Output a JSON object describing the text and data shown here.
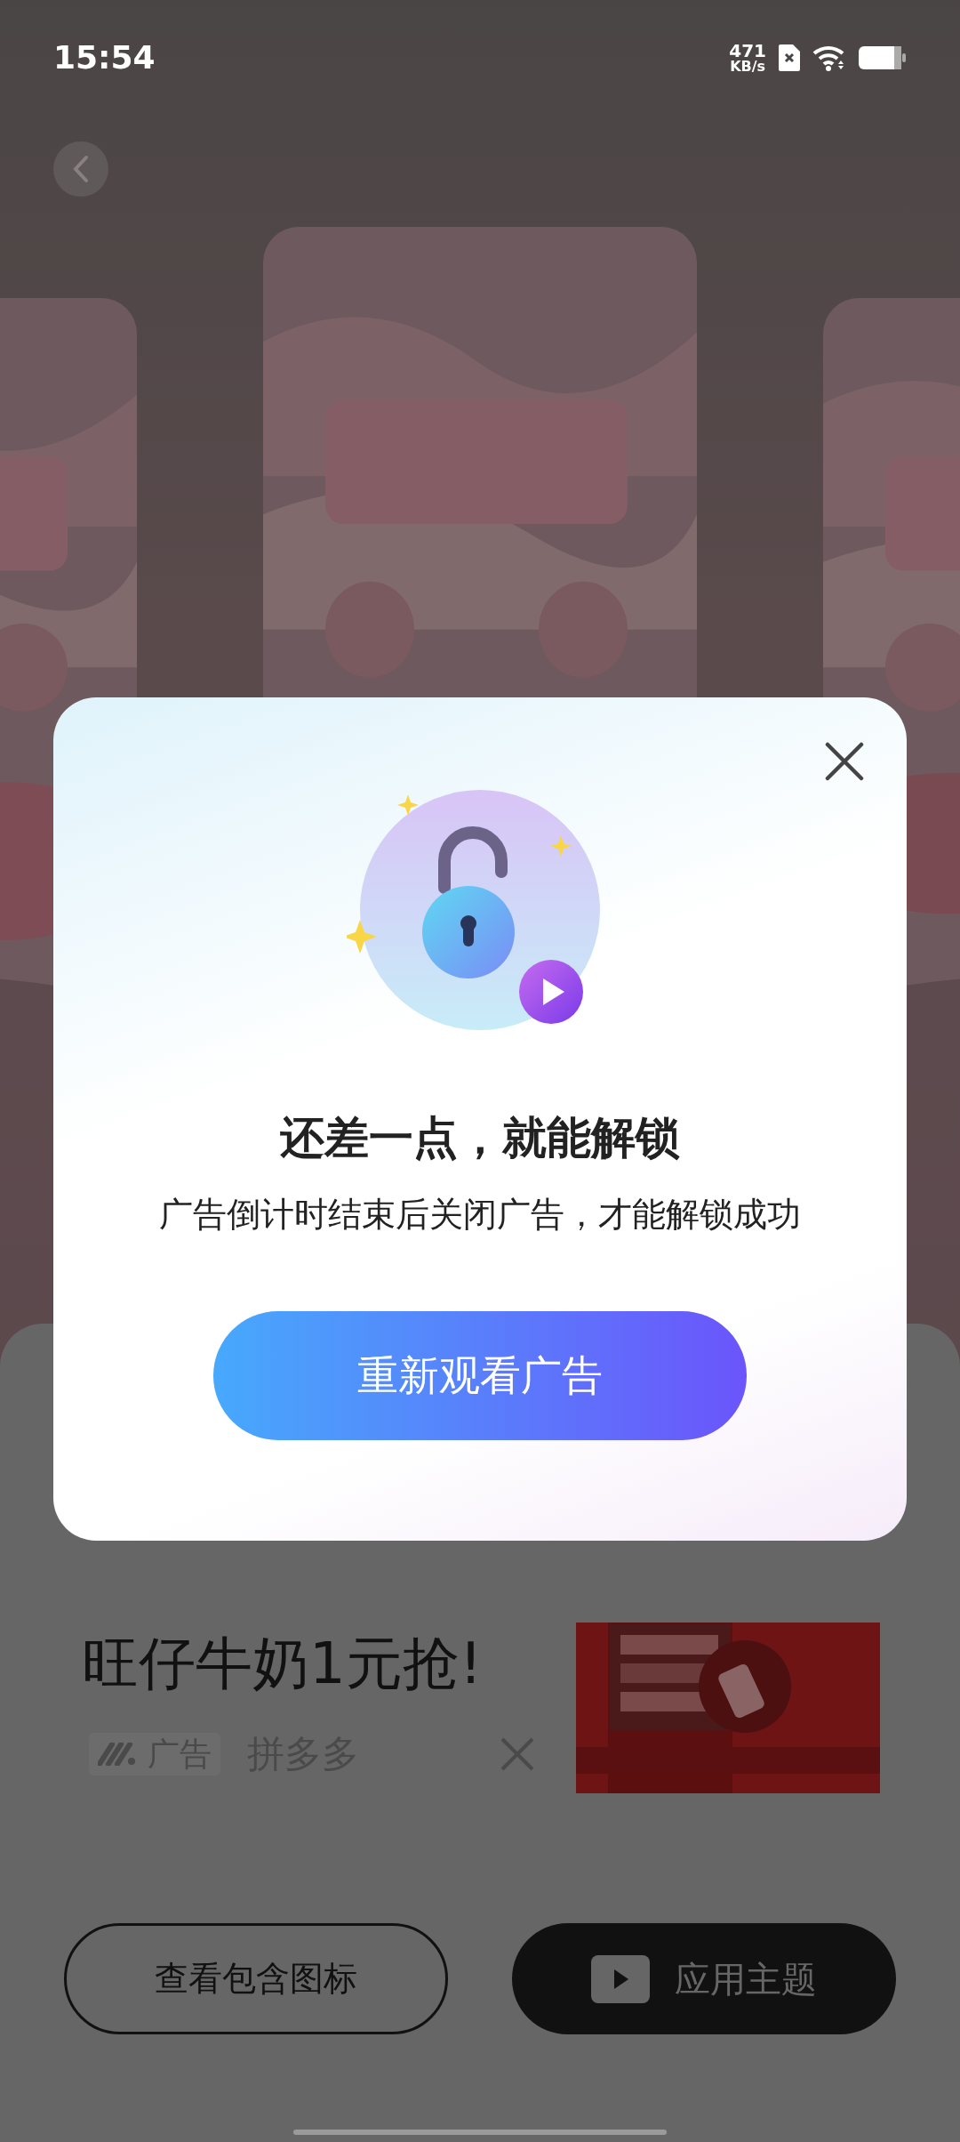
{
  "status_bar": {
    "time": "15:54",
    "net_speed_value": "471",
    "net_speed_unit": "KB/s"
  },
  "dialog": {
    "title": "还差一点，就能解锁",
    "message": "广告倒计时结束后关闭广告，才能解锁成功",
    "button": "重新观看广告"
  },
  "ad": {
    "title": "旺仔牛奶1元抢!",
    "tag": "广告",
    "advertiser": "拼多多"
  },
  "buttons": [
    {
      "label": "查看包含图标",
      "kind": "outline"
    },
    {
      "label": "应用主题",
      "kind": "filled"
    }
  ]
}
